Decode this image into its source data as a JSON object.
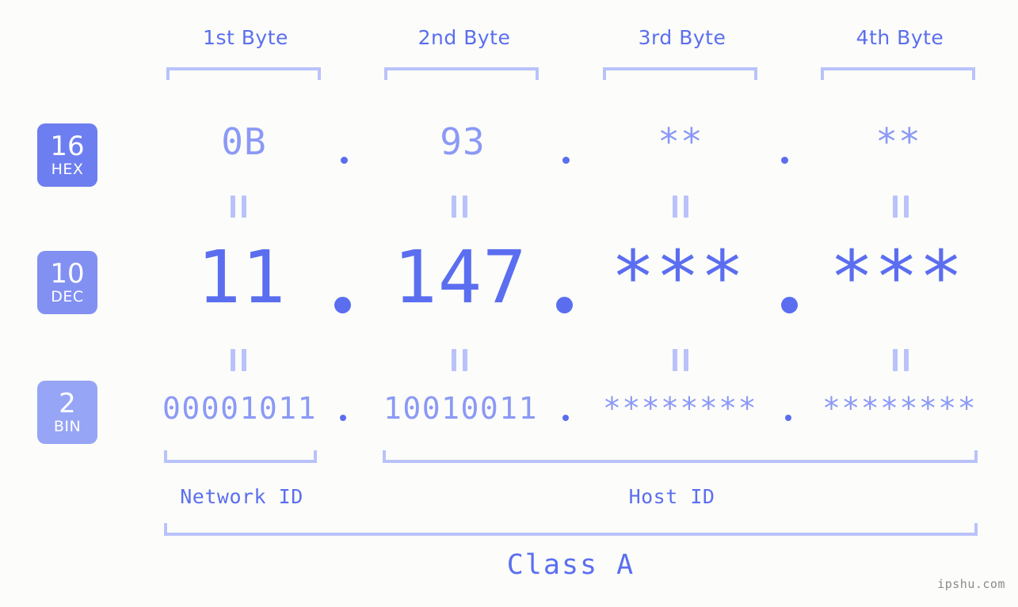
{
  "background_color": "#fcfdfa",
  "accent_color": "#5b6ef0",
  "muted_accent_color": "#8b99f6",
  "bracket_color": "#b9c2fb",
  "headers": [
    {
      "label": "1st Byte"
    },
    {
      "label": "2nd Byte"
    },
    {
      "label": "3rd Byte"
    },
    {
      "label": "4th Byte"
    }
  ],
  "bases": [
    {
      "number": "16",
      "abbr": "HEX",
      "color": "#6d7ef0"
    },
    {
      "number": "10",
      "abbr": "DEC",
      "color": "#8290f2"
    },
    {
      "number": "2",
      "abbr": "BIN",
      "color": "#96a5f5"
    }
  ],
  "rows": {
    "hex": {
      "octets": [
        "0B",
        "93",
        "**",
        "**"
      ]
    },
    "dec": {
      "octets": [
        "11",
        "147",
        "***",
        "***"
      ]
    },
    "bin": {
      "octets": [
        "00001011",
        "10010011",
        "********",
        "********"
      ]
    }
  },
  "separators": {
    "dot": "."
  },
  "equals_marker": "=",
  "sections": {
    "network_id": "Network ID",
    "host_id": "Host ID",
    "class": "Class A"
  },
  "watermark": "ipshu.com"
}
